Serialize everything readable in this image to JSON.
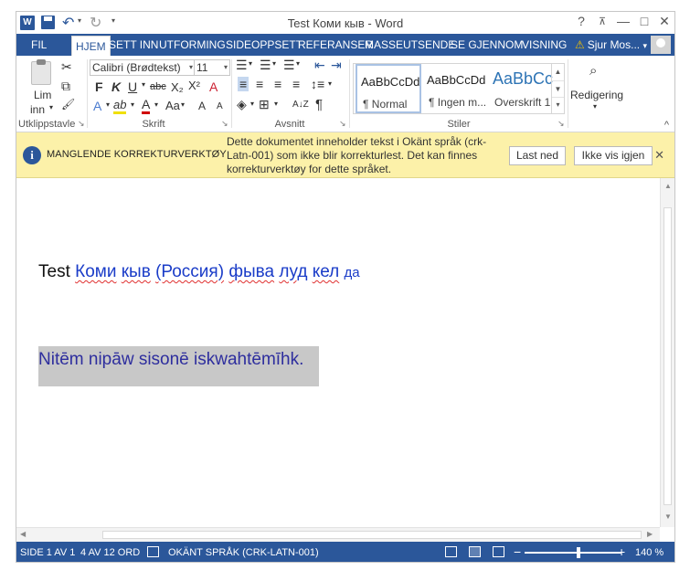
{
  "window": {
    "title": "Test Коми кыв - Word",
    "app_icon": "W",
    "controls": {
      "help": "?",
      "ribbon_display": "⊼",
      "minimize": "—",
      "maximize": "□",
      "close": "✕"
    }
  },
  "quick_access": {
    "undo_icon": "↶",
    "redo_icon": "↻",
    "customize": "▾"
  },
  "tabs": [
    {
      "label": "FIL"
    },
    {
      "label": "HJEM"
    },
    {
      "label": "SETT INN"
    },
    {
      "label": "UTFORMING"
    },
    {
      "label": "SIDEOPPSETT"
    },
    {
      "label": "REFERANSER"
    },
    {
      "label": "MASSEUTSENDE"
    },
    {
      "label": "SE GJENNOM"
    },
    {
      "label": "VISNING"
    }
  ],
  "user": {
    "name": "Sjur Mos...",
    "dropdown": "▾",
    "warning_icon": "⚠"
  },
  "ribbon": {
    "clipboard": {
      "label": "Utklippstavle",
      "paste_label_1": "Lim",
      "paste_label_2": "inn",
      "paste_dropdown": "▾",
      "cut_icon": "✂",
      "copy_icon": "⧉",
      "format_painter_icon": "🖌"
    },
    "font": {
      "label": "Skrift",
      "font_name": "Calibri (Brødtekst)",
      "font_size": "11",
      "grow": "A",
      "shrink": "A",
      "bold": "F",
      "italic": "K",
      "underline": "U",
      "strikethrough": "abc",
      "subscript": "X₂",
      "superscript": "X²",
      "clear_format": "A",
      "text_effects": "A",
      "highlight": "ab",
      "font_color": "A",
      "change_case": "Aa",
      "grow_sym": "A",
      "shrink_sym": "A"
    },
    "paragraph": {
      "label": "Avsnitt",
      "show_marks": "¶",
      "sort": "A↓Z"
    },
    "styles": {
      "label": "Stiler",
      "items": [
        {
          "sample": "AaBbCcDd",
          "name": "¶ Normal"
        },
        {
          "sample": "AaBbCcDd",
          "name": "¶ Ingen m..."
        },
        {
          "sample": "AaBbCc",
          "name": "Overskrift 1"
        }
      ]
    },
    "editing": {
      "label": "Redigering",
      "dropdown": "▾",
      "icon": "binoculars-icon"
    },
    "collapse": "^"
  },
  "message_bar": {
    "title": "MANGLENDE KORREKTURVERKTØY",
    "text": "Dette dokumentet inneholder tekst i Okänt språk (crk-Latn-001) som ikke blir korrekturlest. Det kan finnes korrekturverktøy for dette språket.",
    "download_button": "Last ned",
    "dismiss_button": "Ikke vis igjen",
    "close": "✕"
  },
  "document": {
    "line1_prefix": "Test",
    "line1_words": [
      "Коми",
      "кыв",
      "(Россия)",
      "фыва",
      "луд",
      "кел"
    ],
    "line1_suffix": "да",
    "line2": "Nitēm nipāw sisonē iskwahtēmīhk."
  },
  "status_bar": {
    "page": "SIDE 1 AV 1",
    "words": "4 AV 12 ORD",
    "language": "OKÄNT SPRÅK (CRK-LATN-001)",
    "zoom_minus": "−",
    "zoom_plus": "+",
    "zoom": "140 %",
    "zoom_level_fraction": 0.56
  }
}
